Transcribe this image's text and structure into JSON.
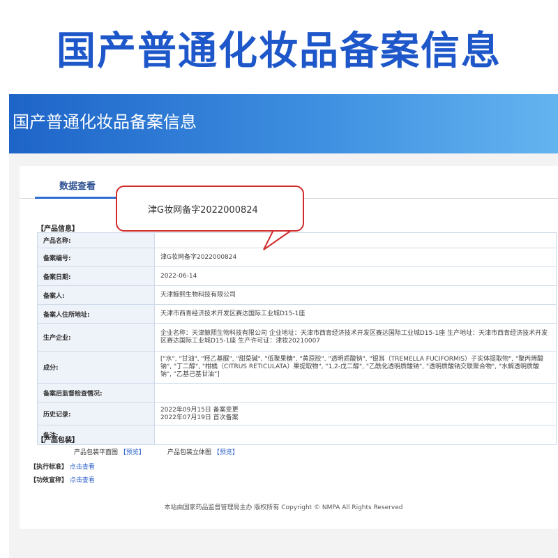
{
  "hero": {
    "title": "国产普通化妆品备案信息"
  },
  "banner": {
    "title": "国产普通化妆品备案信息"
  },
  "tabs": {
    "data_view": "数据查看"
  },
  "sections": {
    "product_info": "【产品信息】",
    "packaging": "【产品包装】",
    "standard": "【执行标准】",
    "efficacy": "【功效宣称】"
  },
  "callout": {
    "text": "津G妆网备字2022000824"
  },
  "rows": [
    {
      "label": "产品名称:",
      "value": ""
    },
    {
      "label": "备案编号:",
      "value": "津G妆网备字2022000824"
    },
    {
      "label": "备案日期:",
      "value": "2022-06-14"
    },
    {
      "label": "备案人:",
      "value": "天津鲸熙生物科技有限公司"
    },
    {
      "label": "备案人住所地址:",
      "value": "天津市西青经济技术开发区赛达国际工业城D15-1座"
    },
    {
      "label": "生产企业:",
      "value": "企业名称：天津鲸熙生物科技有限公司 企业地址：天津市西青经济技术开发区赛达国际工业城D15-1座 生产地址：天津市西青经济技术开发区赛达国际工业城D15-1座 生产许可证：津妆20210007"
    },
    {
      "label": "成分:",
      "value": "[\"水\", \"甘油\", \"羟乙基脲\", \"甜菜碱\", \"低聚果糖\", \"黄原胶\", \"透明质酸钠\", \"银耳（TREMELLA FUCIFORMIS）子实体提取物\", \"聚丙烯酸钠\", \"丁二醇\", \"柑橘（CITRUS RETICULATA）果提取物\", \"1,2-戊二醇\", \"乙酰化透明质酸钠\", \"透明质酸钠交联聚合物\", \"水解透明质酸钠\", \"乙基己基甘油\"]"
    },
    {
      "label": "备案后监督检查情况:",
      "value": ""
    },
    {
      "label": "历史记录:",
      "value": "2022年09月15日 备案变更\n2022年07月19日 首次备案"
    },
    {
      "label": "备注:",
      "value": ""
    }
  ],
  "packaging": {
    "flat_label": "产品包装平面图",
    "flat_link": "【预览】",
    "solid_label": "产品包装立体图",
    "solid_link": "【预览】"
  },
  "links": {
    "standard_link": "点击查看",
    "efficacy_link": "点击查看"
  },
  "footer": {
    "text": "本站由国家药品监督管理局主办 版权所有 Copyright © NMPA All Rights Reserved"
  },
  "colors": {
    "hero_title": "#1e57c9",
    "banner": "#2f78d6",
    "callout_border": "#d02a2a",
    "link": "#2f62c8"
  }
}
